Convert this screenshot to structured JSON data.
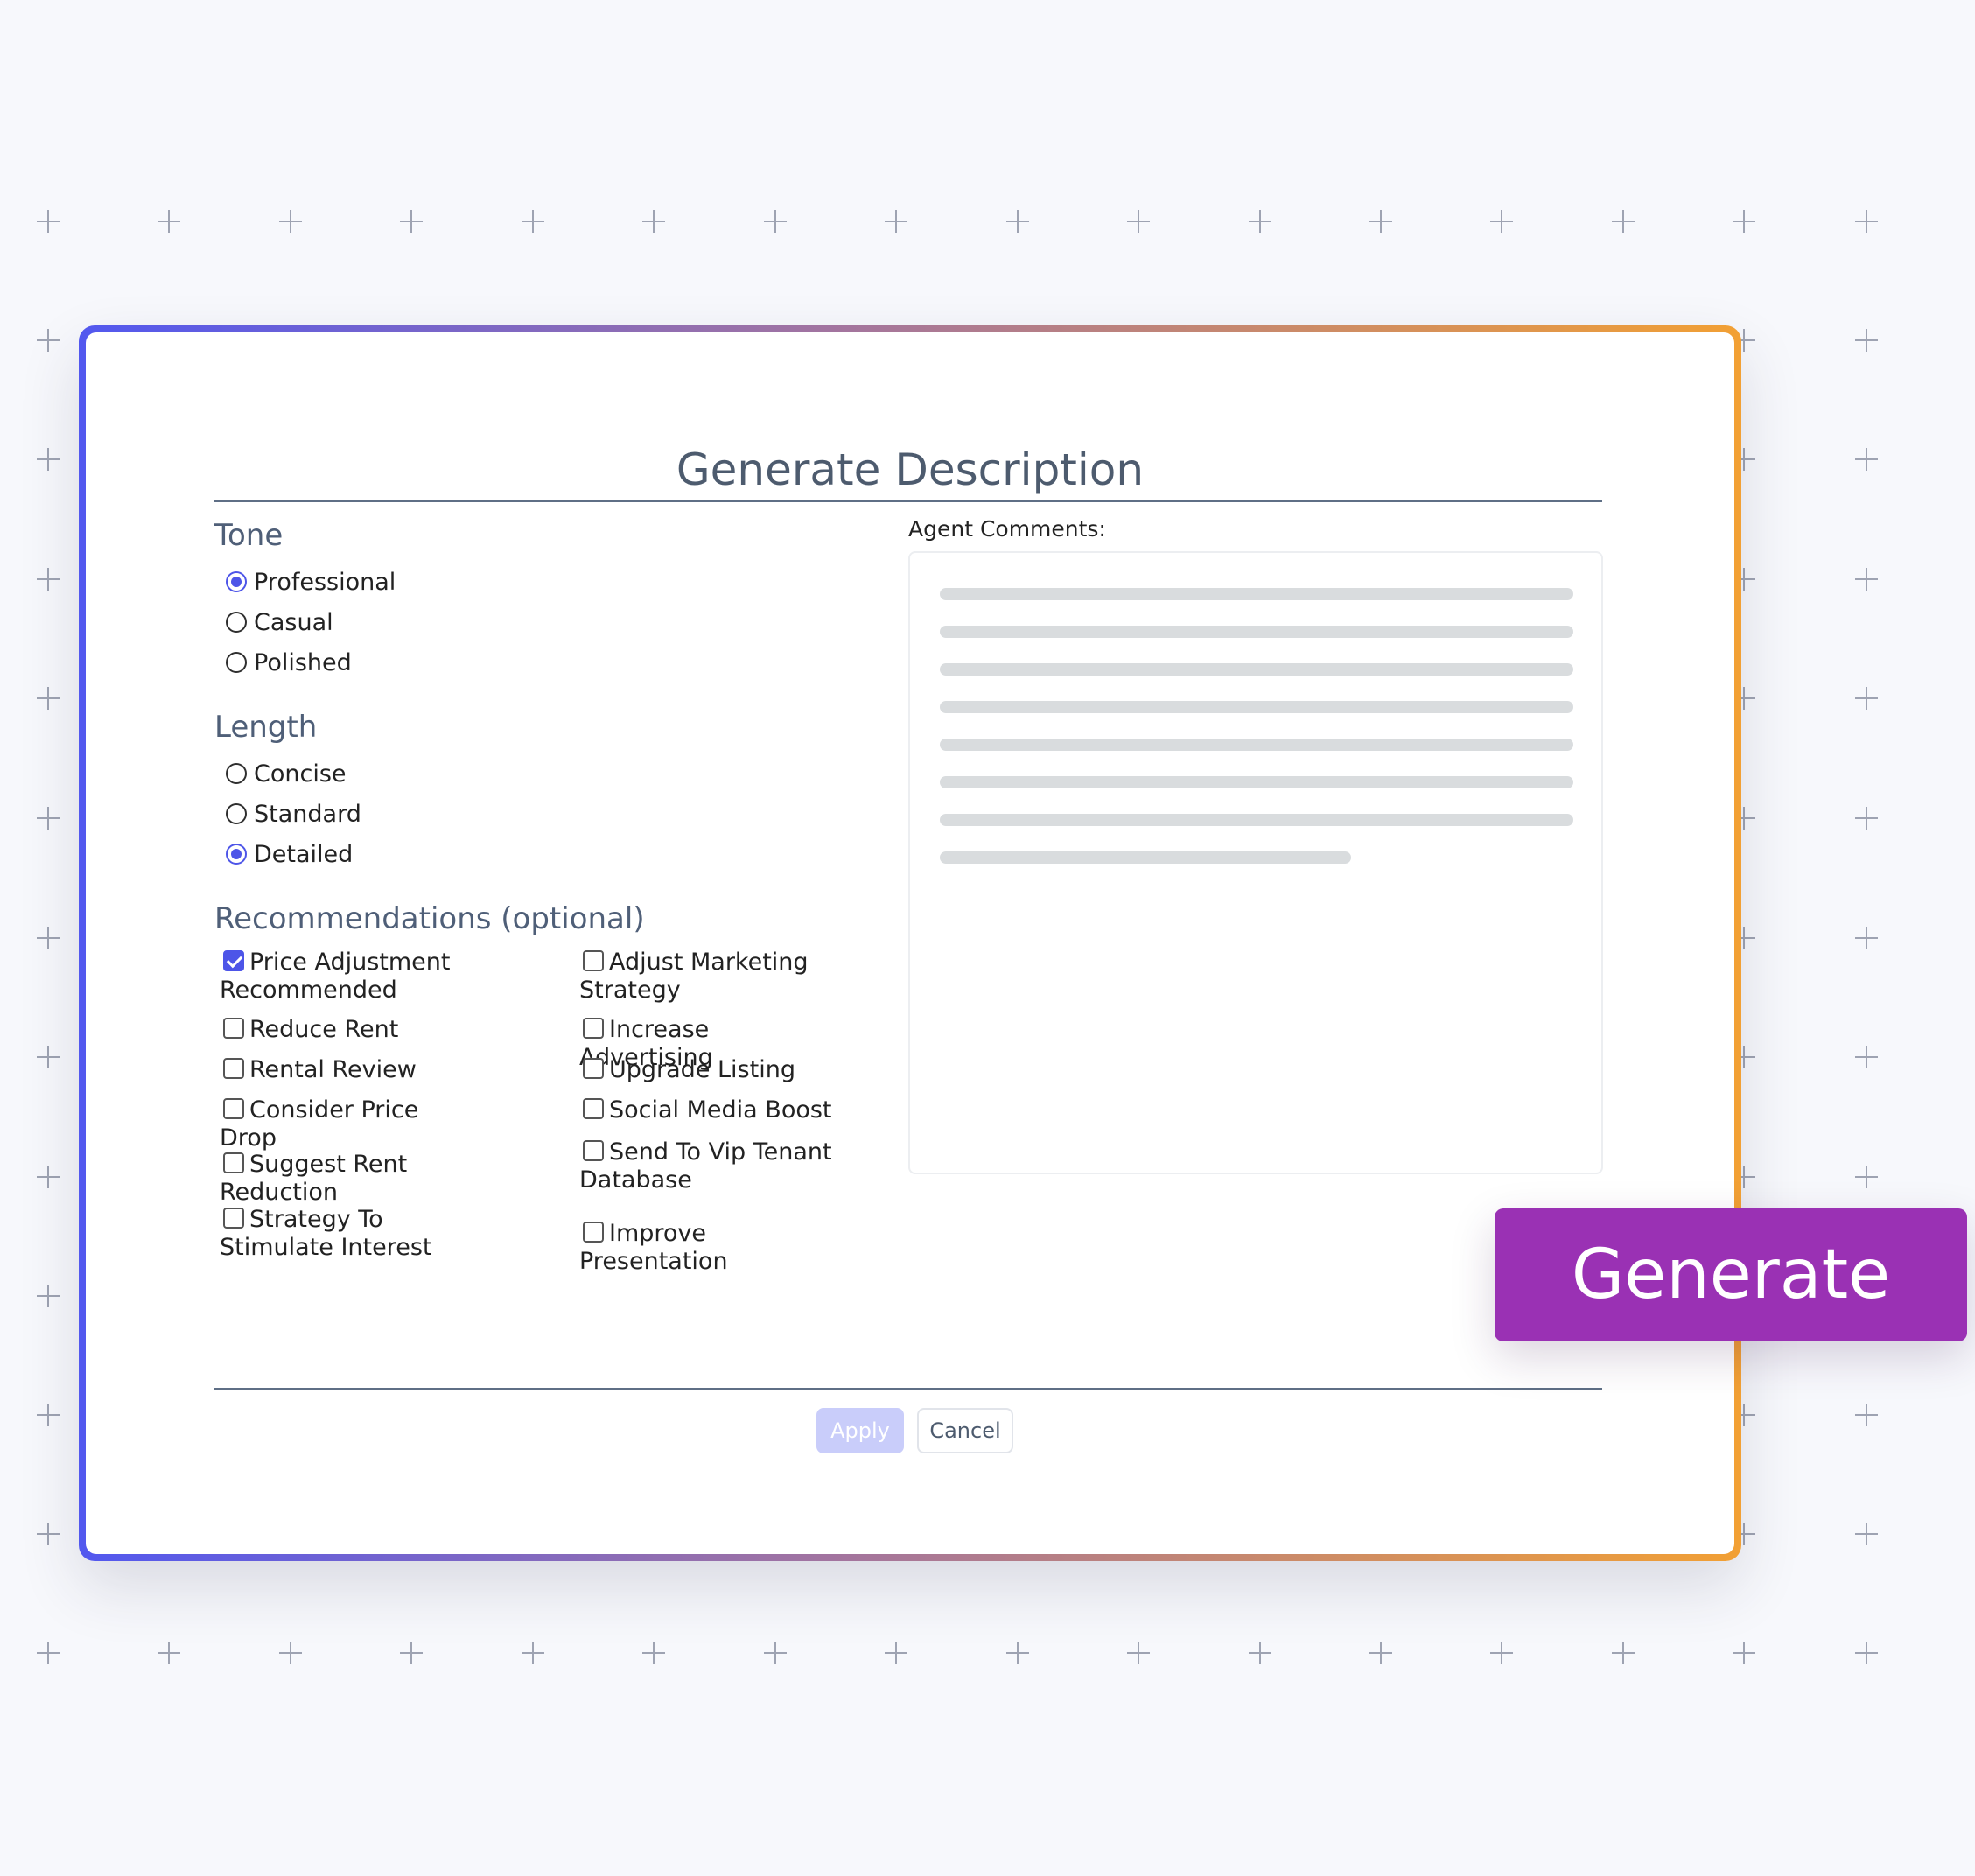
{
  "dialog": {
    "title": "Generate Description",
    "tone": {
      "heading": "Tone",
      "options": [
        {
          "label": "Professional",
          "selected": true
        },
        {
          "label": "Casual",
          "selected": false
        },
        {
          "label": "Polished",
          "selected": false
        }
      ]
    },
    "length": {
      "heading": "Length",
      "options": [
        {
          "label": "Concise",
          "selected": false
        },
        {
          "label": "Standard",
          "selected": false
        },
        {
          "label": "Detailed",
          "selected": true
        }
      ]
    },
    "recommendations": {
      "heading": "Recommendations (optional)",
      "left": [
        {
          "label": "Price Adjustment Recommended",
          "checked": true
        },
        {
          "label": "Reduce Rent",
          "checked": false
        },
        {
          "label": "Rental Review",
          "checked": false
        },
        {
          "label": "Consider Price Drop",
          "checked": false
        },
        {
          "label": "Suggest Rent Reduction",
          "checked": false
        },
        {
          "label": "Strategy To Stimulate Interest",
          "checked": false
        }
      ],
      "right": [
        {
          "label": "Adjust Marketing Strategy",
          "checked": false
        },
        {
          "label": "Increase Advertising",
          "checked": false
        },
        {
          "label": "Upgrade Listing",
          "checked": false
        },
        {
          "label": "Social Media Boost",
          "checked": false
        },
        {
          "label": "Send To Vip Tenant Database",
          "checked": false
        },
        {
          "label": "Improve Presentation",
          "checked": false
        }
      ]
    },
    "comments": {
      "label": "Agent Comments:",
      "value": ""
    },
    "buttons": {
      "apply": "Apply",
      "cancel": "Cancel"
    }
  },
  "cta": {
    "label": "Generate"
  },
  "colors": {
    "accent": "#4d55e8",
    "cta": "#9a31b4",
    "frame_start": "#5258ef",
    "frame_end": "#f2a034",
    "apply_disabled": "#c9cdfa"
  },
  "icons": [
    "plus-icon",
    "radio-icon",
    "checkbox-icon",
    "checkmark-icon"
  ]
}
